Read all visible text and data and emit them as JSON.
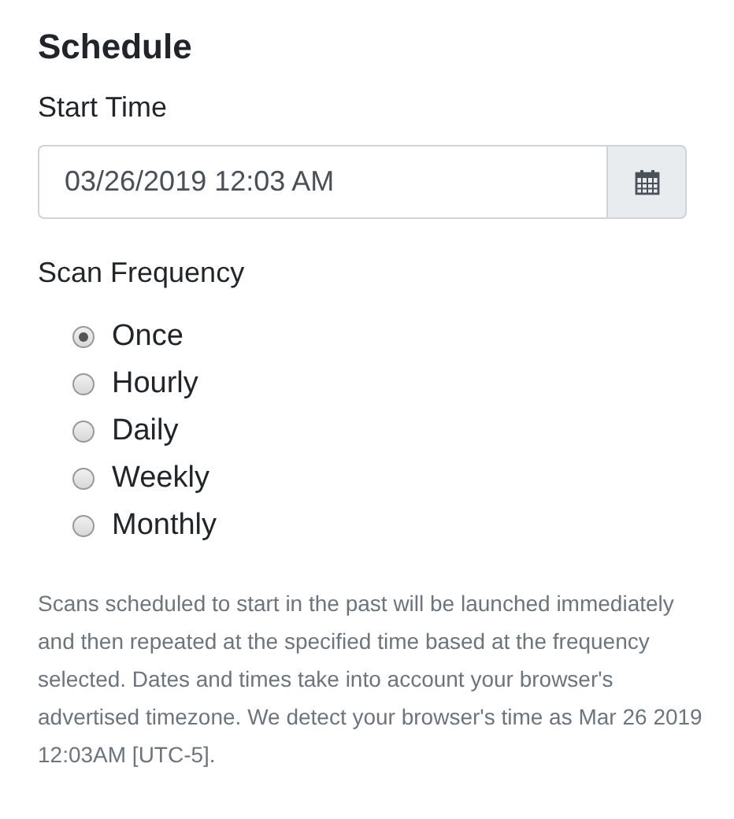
{
  "heading": "Schedule",
  "start_time": {
    "label": "Start Time",
    "value": "03/26/2019 12:03 AM"
  },
  "frequency": {
    "label": "Scan Frequency",
    "options": [
      {
        "label": "Once",
        "selected": true
      },
      {
        "label": "Hourly",
        "selected": false
      },
      {
        "label": "Daily",
        "selected": false
      },
      {
        "label": "Weekly",
        "selected": false
      },
      {
        "label": "Monthly",
        "selected": false
      }
    ]
  },
  "help_text": "Scans scheduled to start in the past will be launched immediately and then repeated at the specified time based at the frequency selected. Dates and times take into account your browser's advertised timezone. We detect your browser's time as Mar 26 2019 12:03AM [UTC-5]."
}
